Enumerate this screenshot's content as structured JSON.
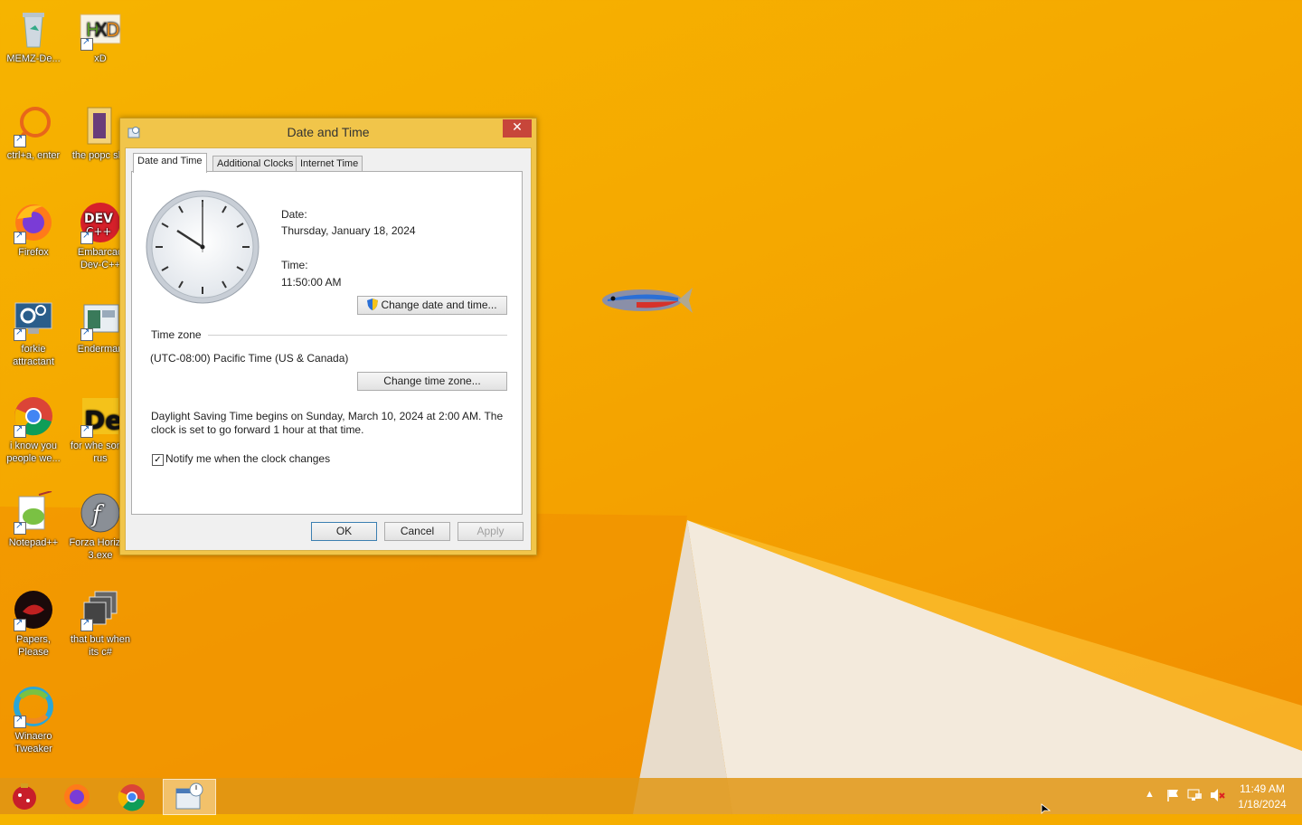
{
  "desktop": {
    "icons": [
      {
        "label": "MEMZ-De...",
        "icon": "recycle-bin-icon"
      },
      {
        "label": "xD",
        "icon": "xd-icon"
      },
      {
        "label": "ctrl+a, enter",
        "icon": "search-ring-icon"
      },
      {
        "label": "the popc shit",
        "icon": "folder-icon"
      },
      {
        "label": "Firefox",
        "icon": "firefox-icon"
      },
      {
        "label": "Embarcad Dev-C++",
        "icon": "devcpp-icon"
      },
      {
        "label": "forkie attractant",
        "icon": "monitor-gear-icon"
      },
      {
        "label": "Enderman",
        "icon": "window-icon"
      },
      {
        "label": "i know you people we...",
        "icon": "chrome-icon"
      },
      {
        "label": "for whe some rus",
        "icon": "de-icon"
      },
      {
        "label": "Notepad++",
        "icon": "notepadpp-icon"
      },
      {
        "label": "Forza Horizon 3.exe",
        "icon": "flash-icon"
      },
      {
        "label": "Papers, Please",
        "icon": "papers-please-icon"
      },
      {
        "label": "that but when its c#",
        "icon": "stack-icon"
      },
      {
        "label": "Winaero Tweaker",
        "icon": "winaero-icon"
      }
    ]
  },
  "dialog": {
    "title": "Date and Time",
    "close_label": "✕",
    "tabs": [
      {
        "label": "Date and Time",
        "active": true
      },
      {
        "label": "Additional Clocks",
        "active": false
      },
      {
        "label": "Internet Time",
        "active": false
      }
    ],
    "date_label": "Date:",
    "date_value": "Thursday, January 18, 2024",
    "time_label": "Time:",
    "time_value": "11:50:00 AM",
    "change_datetime_button": "Change date and time...",
    "timezone_heading": "Time zone",
    "timezone_value": "(UTC-08:00) Pacific Time (US & Canada)",
    "change_timezone_button": "Change time zone...",
    "dst_line1": "Daylight Saving Time begins on Sunday, March 10, 2024 at 2:00 AM. The",
    "dst_line2": "clock is set to go forward 1 hour at that time.",
    "notify_label": "Notify me when the clock changes",
    "notify_checked": true,
    "ok_button": "OK",
    "cancel_button": "Cancel",
    "apply_button": "Apply"
  },
  "taskbar": {
    "apps": [
      {
        "icon": "memz-ornament-icon"
      },
      {
        "icon": "firefox-icon"
      },
      {
        "icon": "chrome-icon"
      },
      {
        "icon": "date-time-app-icon",
        "active": true
      }
    ],
    "tray_icons": [
      "show-hidden-icons-chevron",
      "action-center-flag-icon",
      "network-icon",
      "volume-muted-icon"
    ],
    "clock_time": "11:49 AM",
    "clock_date": "1/18/2024"
  },
  "colors": {
    "wallpaper": "#f5a800",
    "titlebar": "#f1c54a",
    "close_button": "#c7463a",
    "default_button_border": "#3c7fb1"
  }
}
